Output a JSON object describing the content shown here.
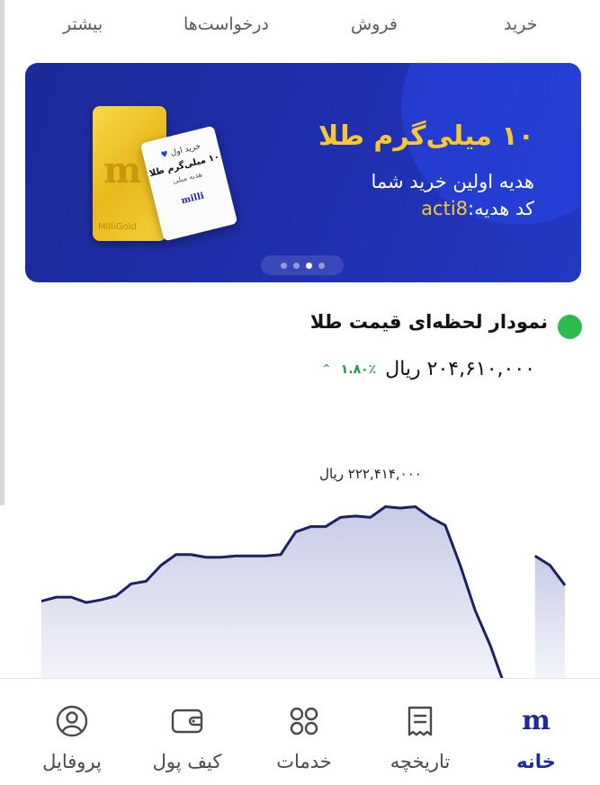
{
  "top_tabs": [
    {
      "label": "بیشتر"
    },
    {
      "label": "درخواست‌ها"
    },
    {
      "label": "فروش"
    },
    {
      "label": "خرید"
    }
  ],
  "banner": {
    "title": "۱۰ میلی‌گرم طلا",
    "subtitle": "هدیه اولین خرید شما",
    "code_label": "کد هدیه:",
    "code_value": "acti8",
    "card_line1": "خرید اول",
    "card_line2": "۱۰ میلی‌گرم طلا",
    "card_line3": "هدیه میلی",
    "card_brand": "milli",
    "gold_brand": "MilliGold",
    "slides_total": 4,
    "slides_active_index": 2
  },
  "chart_section": {
    "title": "نمودار لحظه‌ای قیمت طلا",
    "price": "۲۰۴,۶۱۰,۰۰۰ ریال",
    "change": "۱.۸۰٪",
    "peak_label": "۲۲۲,۴۱۴,۰۰۰ ریال",
    "colors": {
      "line": "#1c2260",
      "fill_top": "#c8cbe6",
      "fill_bottom": "#f4f5fb",
      "live": "#2dbb4e",
      "up": "#1f9e3d"
    }
  },
  "chart_data": {
    "type": "area",
    "x": [
      0,
      2,
      4,
      6,
      8,
      10,
      12,
      14,
      16,
      18,
      20,
      22,
      24,
      26,
      28,
      30,
      32,
      34,
      36,
      38,
      40,
      42,
      44,
      46,
      48,
      50,
      52,
      54,
      56,
      58,
      60,
      62,
      64,
      66,
      68,
      70,
      72,
      74,
      76,
      78,
      80,
      82,
      84,
      86,
      88,
      90,
      92,
      94,
      96,
      98,
      100
    ],
    "y": [
      0.28,
      0.31,
      0.31,
      0.27,
      0.29,
      0.32,
      0.41,
      0.43,
      0.55,
      0.63,
      0.63,
      0.61,
      0.61,
      0.62,
      0.62,
      0.62,
      0.63,
      0.8,
      0.84,
      0.84,
      0.91,
      0.92,
      0.91,
      0.99,
      0.98,
      0.99,
      0.91,
      0.85,
      0.55,
      0.21,
      -0.05,
      -0.4,
      -0.4,
      0.62,
      0.55,
      0.4
    ],
    "title": "نمودار لحظه‌ای قیمت طلا",
    "annotations": [
      "۲۲۲,۴۱۴,۰۰۰ ریال"
    ]
  },
  "bottom_nav": [
    {
      "label": "پروفایل",
      "icon": "profile-icon"
    },
    {
      "label": "کیف پول",
      "icon": "wallet-icon"
    },
    {
      "label": "خدمات",
      "icon": "services-icon"
    },
    {
      "label": "تاریخچه",
      "icon": "history-icon"
    },
    {
      "label": "خانه",
      "icon": "home-logo-icon",
      "active": true
    }
  ]
}
